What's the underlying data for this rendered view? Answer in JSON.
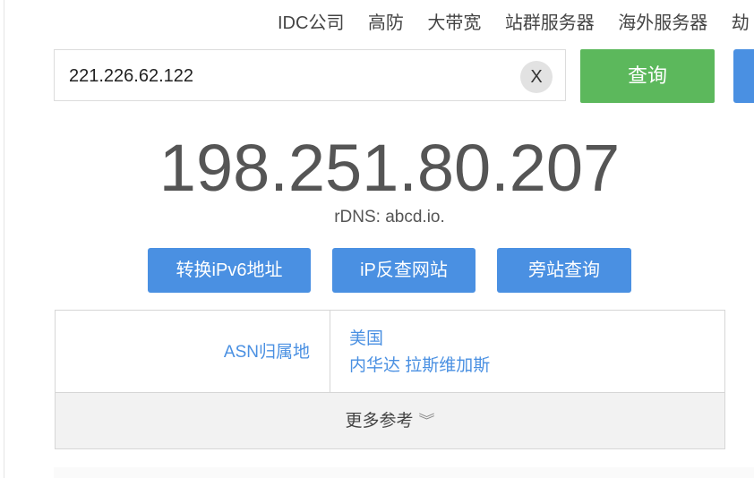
{
  "nav": {
    "items": [
      "IDC公司",
      "高防",
      "大带宽",
      "站群服务器",
      "海外服务器",
      "劫"
    ]
  },
  "search": {
    "value": "221.226.62.122",
    "clear_label": "X",
    "query_label": "查询"
  },
  "result": {
    "ip": "198.251.80.207",
    "rdns": "rDNS: abcd.io."
  },
  "actions": {
    "ipv6": "转换iPv6地址",
    "reverse": "iP反查网站",
    "sibling": "旁站查询"
  },
  "table": {
    "asn_label": "ASN归属地",
    "country": "美国",
    "region": "内华达 拉斯维加斯",
    "more": "更多参考"
  },
  "colors": {
    "accent_blue": "#4a90e2",
    "query_green": "#5cb85c"
  }
}
